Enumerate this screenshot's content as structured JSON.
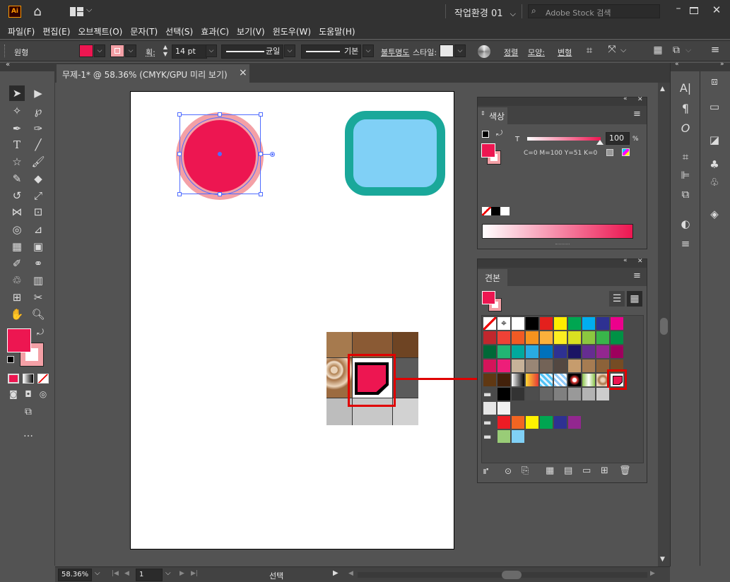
{
  "titlebar": {
    "logo": "Ai",
    "workspace": "작업환경 01",
    "search_placeholder": "Adobe Stock 검색"
  },
  "menu": [
    "파일(F)",
    "편집(E)",
    "오브젝트(O)",
    "문자(T)",
    "선택(S)",
    "효과(C)",
    "보기(V)",
    "윈도우(W)",
    "도움말(H)"
  ],
  "control": {
    "selection_label": "원형",
    "stroke_label": "획:",
    "stroke_value": "14 pt",
    "profile1": "균일",
    "profile2": "기본",
    "opacity_label": "불투명도",
    "style_label": "스타일:",
    "align_label": "정렬",
    "shape_label": "모양:",
    "transform_label": "변형"
  },
  "document": {
    "tab_title": "무제-1* @ 58.36% (CMYK/GPU 미리 보기)",
    "close": "×"
  },
  "color_panel": {
    "title": "색상",
    "t_label": "T",
    "t_value": "100",
    "percent": "%",
    "readout": "C=0 M=100 Y=51 K=0"
  },
  "swatches_panel": {
    "title": "견본"
  },
  "status": {
    "zoom": "58.36%",
    "page": "1",
    "tool": "선택"
  },
  "colors": {
    "accent_fill": "#ed1651",
    "stroke_pink": "#f4a0a6",
    "rounded_fill": "#80d0f6",
    "rounded_stroke": "#1aa89a",
    "highlight": "#e00000"
  },
  "icons": [
    "home-icon",
    "layout-icon",
    "search-icon",
    "minimize-icon",
    "maximize-icon",
    "close-icon",
    "selection-tool-icon",
    "direct-selection-icon",
    "type-tool-icon",
    "hand-tool-icon",
    "zoom-tool-icon",
    "list-view-icon",
    "grid-view-icon",
    "trash-icon"
  ]
}
